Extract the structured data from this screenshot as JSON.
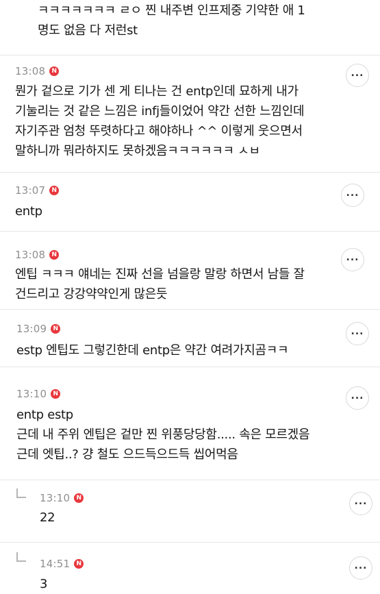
{
  "comments": [
    {
      "time": "",
      "text": "ㅋㅋㅋㅋㅋㅋㅋ ㄹㅇ 찐 내주변 인프제중 기약한 애 1\n명도 없음 다 저런st"
    },
    {
      "time": "13:08",
      "badge": "N",
      "text": "뭔가 겉으로 기가 센 게 티나는 건 entp인데 묘하게 내가\n기눌리는 것 같은 느낌은 infj들이었어 약간 선한 느낌인데\n자기주관 엄청 뚜렷하다고 해야하나 ^^ 이렇게 웃으면서\n말하니까 뭐라하지도 못하겠음ㅋㅋㅋㅋㅋㅋ ㅅㅂ"
    },
    {
      "time": "13:07",
      "badge": "N",
      "text": "entp"
    },
    {
      "time": "13:08",
      "badge": "N",
      "text": "엔팁 ㅋㅋㅋ 얘네는 진짜 선을 넘을랑 말랑 하면서 남들 잘\n건드리고 강강약약인게 많은듯"
    },
    {
      "time": "13:09",
      "badge": "N",
      "text": "estp 엔팁도 그렇긴한데 entp은 약간 여려가지곰ㅋㅋ"
    },
    {
      "time": "13:10",
      "badge": "N",
      "text": "entp estp\n근데 내 주위 엔팁은 겉만 찐 위풍당당함..... 속은 모르겠음\n근데 엣팁..? 걍 철도 으드득으드득 씹어먹음"
    },
    {
      "time": "13:10",
      "badge": "N",
      "text": "22"
    },
    {
      "time": "14:51",
      "badge": "N",
      "text": "3"
    }
  ],
  "more_label": "..."
}
